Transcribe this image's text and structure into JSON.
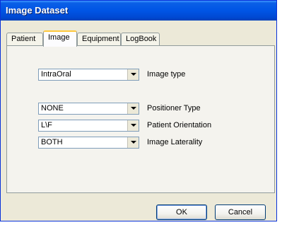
{
  "window": {
    "title": "Image Dataset"
  },
  "tabs": [
    {
      "label": "Patient"
    },
    {
      "label": "Image"
    },
    {
      "label": "Equipment"
    },
    {
      "label": "LogBook"
    }
  ],
  "active_tab": "Image",
  "fields": {
    "image_type": {
      "label": "Image type",
      "value": "IntraOral"
    },
    "positioner_type": {
      "label": "Positioner Type",
      "value": "NONE"
    },
    "patient_orientation": {
      "label": "Patient Orientation",
      "value": "L\\F"
    },
    "image_laterality": {
      "label": "Image Laterality",
      "value": "BOTH"
    }
  },
  "buttons": {
    "ok": "OK",
    "cancel": "Cancel"
  },
  "colors": {
    "titlebar": "#0055e5",
    "dialog_bg": "#ece9d8",
    "active_tab_accent": "#ffc83c"
  }
}
